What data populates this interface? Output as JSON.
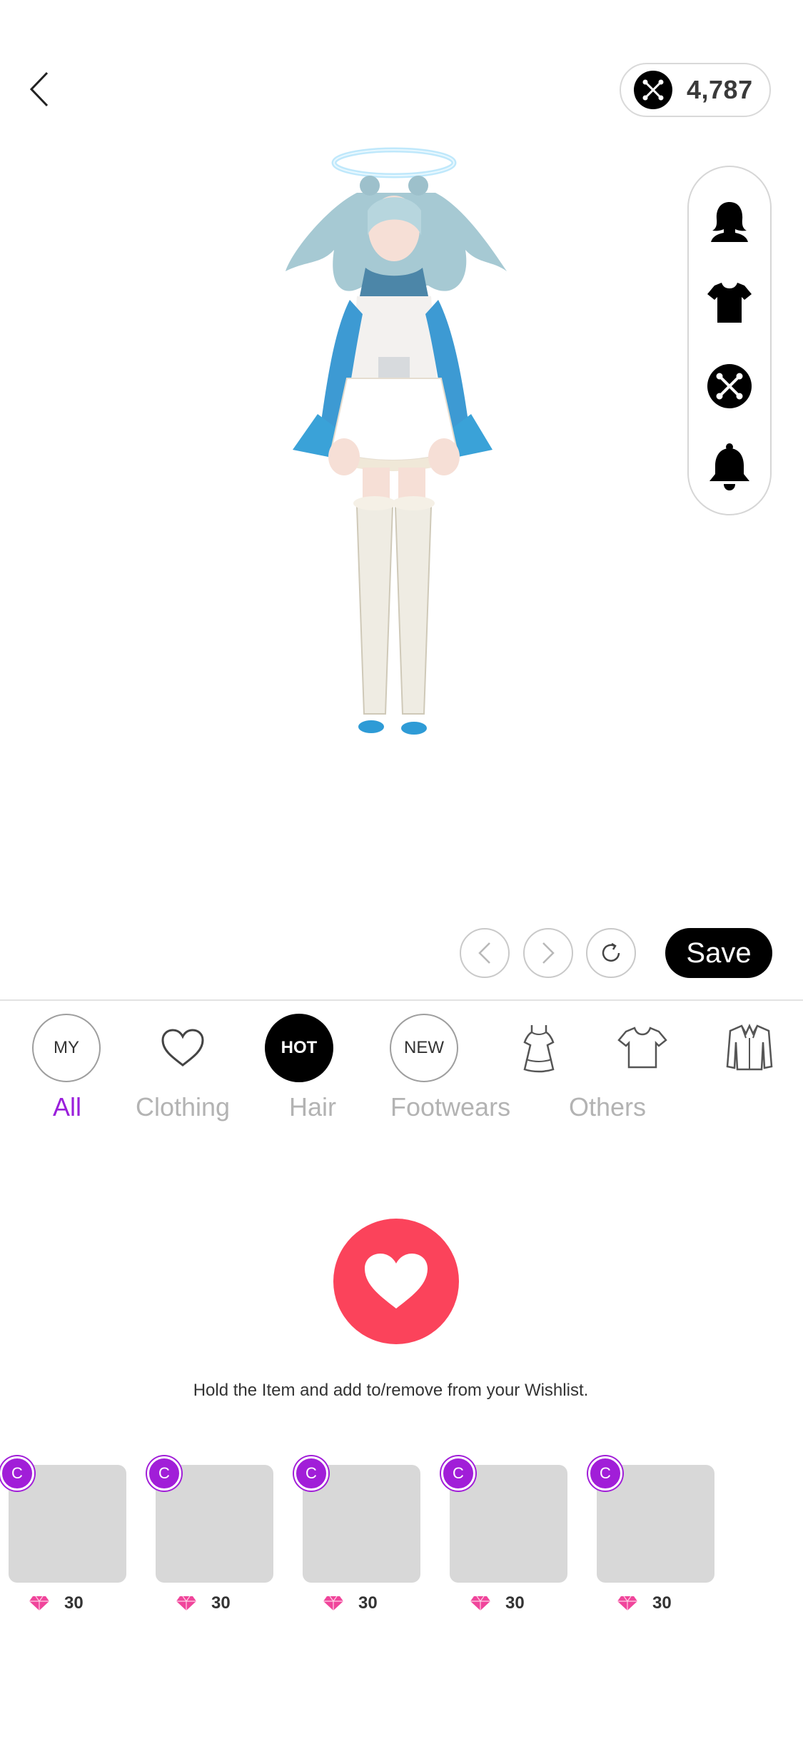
{
  "header": {
    "back_label": "<",
    "coins": "4,787"
  },
  "tools": [
    {
      "name": "hair",
      "icon": "head-silhouette-icon"
    },
    {
      "name": "clothing",
      "icon": "tshirt-icon"
    },
    {
      "name": "currency",
      "icon": "coin-x-icon"
    },
    {
      "name": "notifications",
      "icon": "bell-icon"
    }
  ],
  "controls": {
    "save_label": "Save"
  },
  "filters": [
    {
      "label": "MY",
      "style": "outline"
    },
    {
      "label": "",
      "icon": "heart-outline-icon"
    },
    {
      "label": "HOT",
      "style": "filled"
    },
    {
      "label": "NEW",
      "style": "outline"
    },
    {
      "label": "",
      "icon": "dress-icon"
    },
    {
      "label": "",
      "icon": "tshirt-outline-icon"
    },
    {
      "label": "",
      "icon": "jacket-icon"
    }
  ],
  "tabs": [
    "All",
    "Clothing",
    "Hair",
    "Footwears",
    "Others"
  ],
  "active_tab": "All",
  "wishlist": {
    "hint": "Hold the Item and add to/remove from your Wishlist."
  },
  "items": [
    {
      "badge": "C",
      "price": "30"
    },
    {
      "badge": "C",
      "price": "30"
    },
    {
      "badge": "C",
      "price": "30"
    },
    {
      "badge": "C",
      "price": "30"
    },
    {
      "badge": "C",
      "price": "30"
    }
  ],
  "colors": {
    "accent": "#9a1fdb",
    "heart": "#fb435b",
    "badge": "#a11ed8",
    "gem": "#f0459b"
  }
}
